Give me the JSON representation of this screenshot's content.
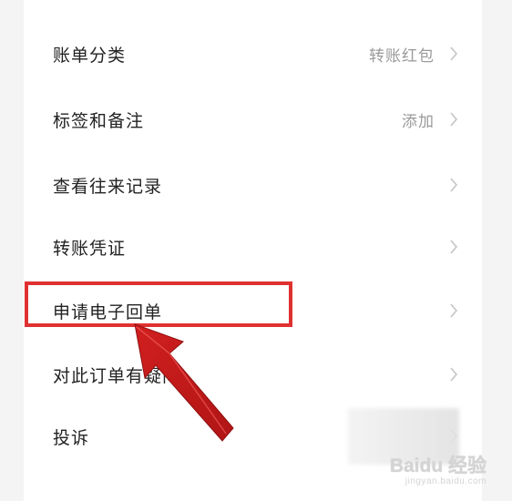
{
  "menu": {
    "items": [
      {
        "label": "账单分类",
        "value": "转账红包"
      },
      {
        "label": "标签和备注",
        "value": "添加"
      },
      {
        "label": "查看往来记录",
        "value": ""
      },
      {
        "label": "转账凭证",
        "value": ""
      },
      {
        "label": "申请电子回单",
        "value": ""
      },
      {
        "label": "对此订单有疑问",
        "value": ""
      },
      {
        "label": "投诉",
        "value": ""
      }
    ]
  },
  "annotation": {
    "highlighted_item": "申请电子回单",
    "box_color": "#e03131",
    "arrow_color": "#e03131"
  },
  "watermark": {
    "main": "Baidu 经验",
    "sub": "jingyan.baidu.com"
  },
  "icons": {
    "row_chevron": "chevron-right-icon"
  }
}
